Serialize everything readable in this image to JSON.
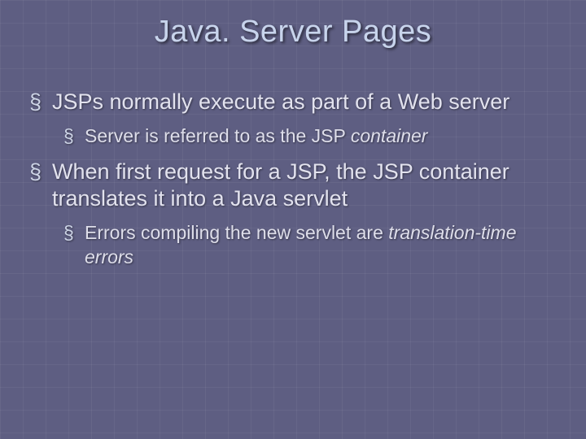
{
  "title": "Java. Server Pages",
  "bullets": [
    {
      "text": "JSPs normally execute as part of a Web server",
      "sub": [
        {
          "prefix": "Server is referred to as the JSP ",
          "emph": "container"
        }
      ]
    },
    {
      "text": "When first request for a JSP, the JSP container translates it into a Java servlet",
      "sub": [
        {
          "prefix": "Errors compiling the new servlet are ",
          "emph": "translation-time errors"
        }
      ]
    }
  ]
}
